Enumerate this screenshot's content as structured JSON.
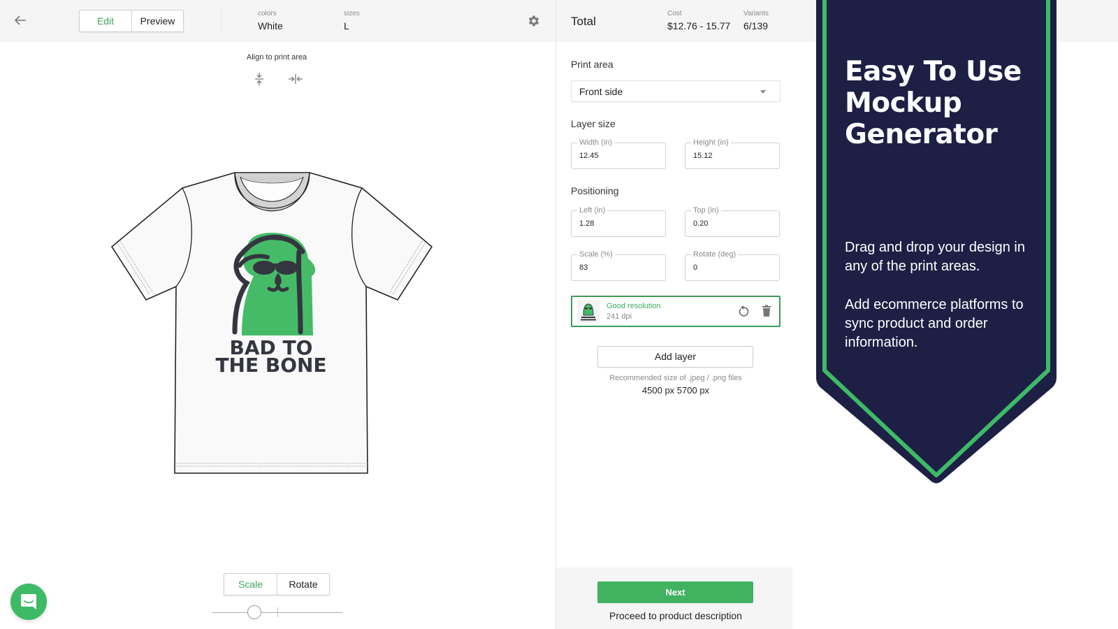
{
  "header": {
    "back_icon": "arrow-left-icon",
    "mode_tabs": [
      {
        "label": "Edit",
        "active": true
      },
      {
        "label": "Preview",
        "active": false
      }
    ],
    "colors_label": "colors",
    "colors_value": "White",
    "sizes_label": "sizes",
    "sizes_value": "L",
    "settings_icon": "gear-icon"
  },
  "canvas": {
    "align_label": "Align to print area",
    "align_icons": [
      "align-vertical-center-icon",
      "align-horizontal-center-icon"
    ],
    "design_text_line1": "BAD TO",
    "design_text_line2": "THE BONE",
    "tool_tabs": [
      {
        "label": "Scale",
        "active": true
      },
      {
        "label": "Rotate",
        "active": false
      }
    ],
    "slider_value_fraction": 0.3
  },
  "summary": {
    "total_label": "Total",
    "cost_label": "Cost",
    "cost_value": "$12.76 - 15.77",
    "variants_label": "Variants",
    "variants_value": "6/139"
  },
  "panel": {
    "print_area_title": "Print area",
    "print_area_value": "Front side",
    "layer_size_title": "Layer size",
    "width_label": "Width (in)",
    "width_value": "12.45",
    "height_label": "Height (in)",
    "height_value": "15.12",
    "positioning_title": "Positioning",
    "left_label": "Left (in)",
    "left_value": "1.28",
    "top_label": "Top (in)",
    "top_value": "0.20",
    "scale_label": "Scale (%)",
    "scale_value": "83",
    "rotate_label": "Rotate (deg)",
    "rotate_value": "0",
    "layer": {
      "status": "Good resolution",
      "dpi": "241 dpi",
      "thumb_text": "BAD TO THE BONE"
    },
    "add_layer_label": "Add layer",
    "recommended_label": "Recommended size of .jpeg / .png files",
    "recommended_size": "4500 px 5700 px",
    "next_label": "Next",
    "proceed_label": "Proceed to product description"
  },
  "banner": {
    "title": "Easy To Use Mockup Generator",
    "paragraph1": "Drag and drop your design in any of the print areas.",
    "paragraph2": "Add ecommerce platforms to sync product and order information.",
    "navy": "#1d1f45",
    "green": "#3dba66"
  },
  "colors": {
    "accent_green": "#41b260",
    "header_bg": "#f5f5f5"
  }
}
